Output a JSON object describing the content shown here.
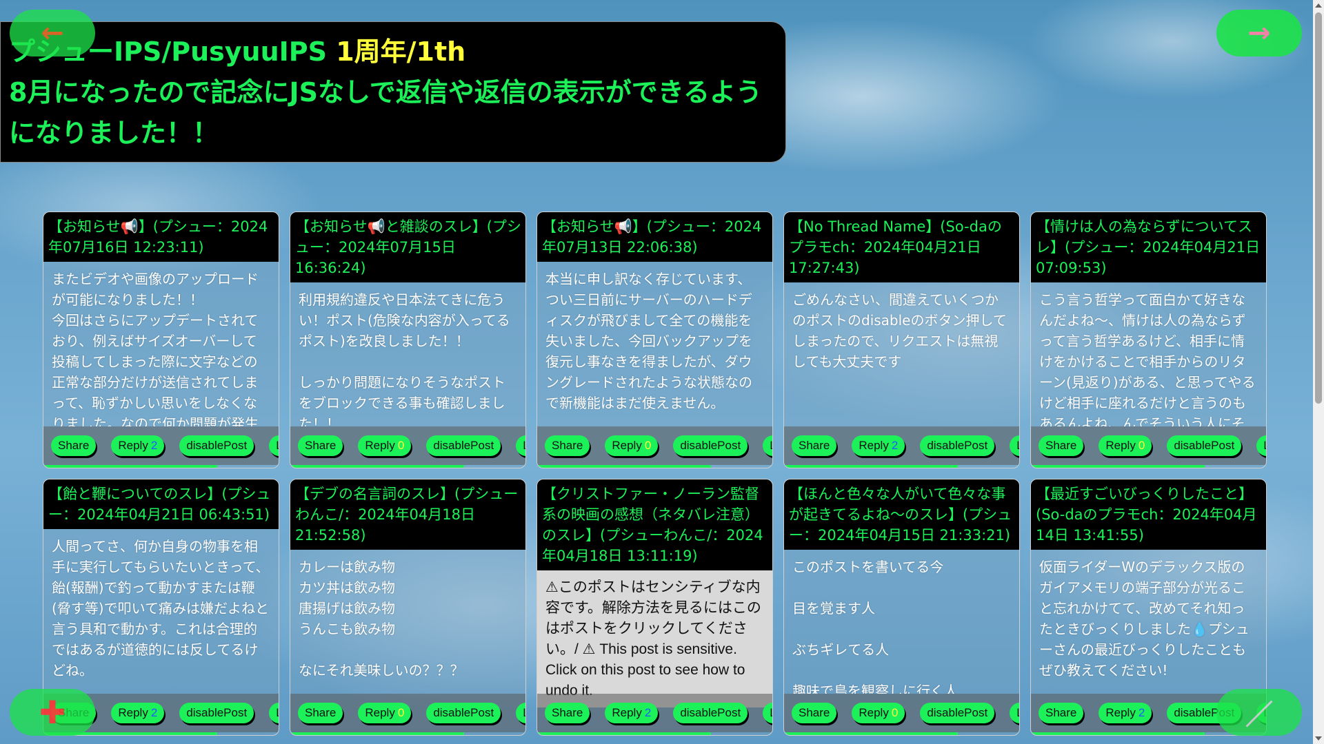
{
  "banner": {
    "line1_main": "プシューIPS/PusyuuIPS ",
    "line1_highlight": "1周年/1th",
    "line2": "8月になったので記念にJSなしで返信や返信の表示ができるようになりました！！"
  },
  "nav": {
    "back_icon": "←",
    "next_icon": "→",
    "add_icon": "✚",
    "edit_icon": "／"
  },
  "actions": {
    "share": "Share",
    "reply": "Reply",
    "disable": "disablePost",
    "like": "Like"
  },
  "posts": [
    {
      "title": "【お知らせ📢】(プシュー：2024年07月16日 12:23:11)",
      "body": "またビデオや画像のアップロードが可能になりました！！\n今回はさらにアップデートされており、例えばサイズオーバーして投稿してしまった際に文字などの正常な部分だけが送信されてしまって、恥ずかしい思いをしなくなりました。なので何か問題が発生",
      "reply_count": "2",
      "progress": 0.74
    },
    {
      "title": "【お知らせ📢と雑談のスレ】(プシュー：2024年07月15日 16:36:24)",
      "body": "利用規約違反や日本法てきに危うい！ポスト(危険な内容が入ってるポスト)を改良しました！！\n\nしっかり問題になりそうなポストをブロックできる事も確認しました！！",
      "reply_count": "0",
      "progress": 0.74
    },
    {
      "title": "【お知らせ📢】(プシュー：2024年07月13日 22:06:38)",
      "body": "本当に申し訳なく存じています、つい三日前にサーバーのハードディスクが飛びまして全ての機能を失いました、今回バックアップを復元し事なきを得ましたが、ダウングレードされたような状態なので新機能はまだ使えません。",
      "reply_count": "0",
      "progress": 0.74
    },
    {
      "title": "【No Thread Name】(So-daのプラモch：2024年04月21日 17:27:43)",
      "body": "ごめんなさい、間違えていくつかのポストのdisableのボタン押してしまったので、リクエストは無視しても大丈夫です",
      "reply_count": "2",
      "progress": 0.74
    },
    {
      "title": "【情けは人の為ならずについてスレ】(プシュー：2024年04月21日 07:09:53)",
      "body": "こう言う哲学って面白かて好きなんだよね〜、情けは人の為ならずって言う哲学あるけど、相手に情けをかけることで相手からのリターン(見返り)がある、と思ってやるけど相手に座れるだけと言うのもあるんよね、んでそういう人にそ",
      "reply_count": "0",
      "progress": 0.74
    },
    {
      "title": "【飴と鞭についてのスレ】(プシュー：2024年04月21日 06:43:51)",
      "body": "人間ってさ、何か自身の物事を相手に実行してもらいたいときって、飴(報酬)で釣って動かすまたは鞭(脅す等)で叩いて痛みは嫌だよねと言う具和で動かす。これは合理的ではあるが道徳的には反してるけどね。",
      "reply_count": "2",
      "progress": 0.74
    },
    {
      "title": "【デブの名言詞のスレ】(プシューわんこ/：2024年04月18日 21:52:58)",
      "body": "カレーは飲み物\nカツ丼は飲み物\n唐揚げは飲み物\nうんこも飲み物\n\nなにそれ美味しいの？？？",
      "reply_count": "0",
      "progress": 0.74
    },
    {
      "title": "【クリストファー・ノーラン監督系の映画の感想（ネタバレ注意）のスレ】(プシューわんこ/：2024年04月18日 13:11:19)",
      "body": "⚠このポストはセンシティブな内容です。解除方法を見るにはこのはポストをクリックしてください。/ ⚠ This post is sensitive. Click on this post to see how to undo it.",
      "reply_count": "2",
      "sensitive": true,
      "progress": 0.74
    },
    {
      "title": "【ほんと色々な人がいて色々な事が起きてるよね〜のスレ】(プシュー：2024年04月15日 21:33:21)",
      "body": "このポストを書いてる今\n\n目を覚ます人\n\nぶちギレてる人\n\n趣味で鳥を観察しに行く人",
      "reply_count": "0",
      "progress": 0.74
    },
    {
      "title": "【最近すごいびっくりしたこと】(So-daのプラモch：2024年04月14日 13:41:55)",
      "body": "仮面ライダーWのデラックス版のガイアメモリの端子部分が光ること忘れかけてて、改めてそれ知ったときびっくりしました💧プシューさんの最近びっくりしたこともぜひ教えてください!",
      "reply_count": "2",
      "progress": 0.74
    }
  ],
  "colors": {
    "accent_green": "#1df15a",
    "highlight_yellow": "#ffff3a",
    "reply_blue": "#1e5bff"
  }
}
